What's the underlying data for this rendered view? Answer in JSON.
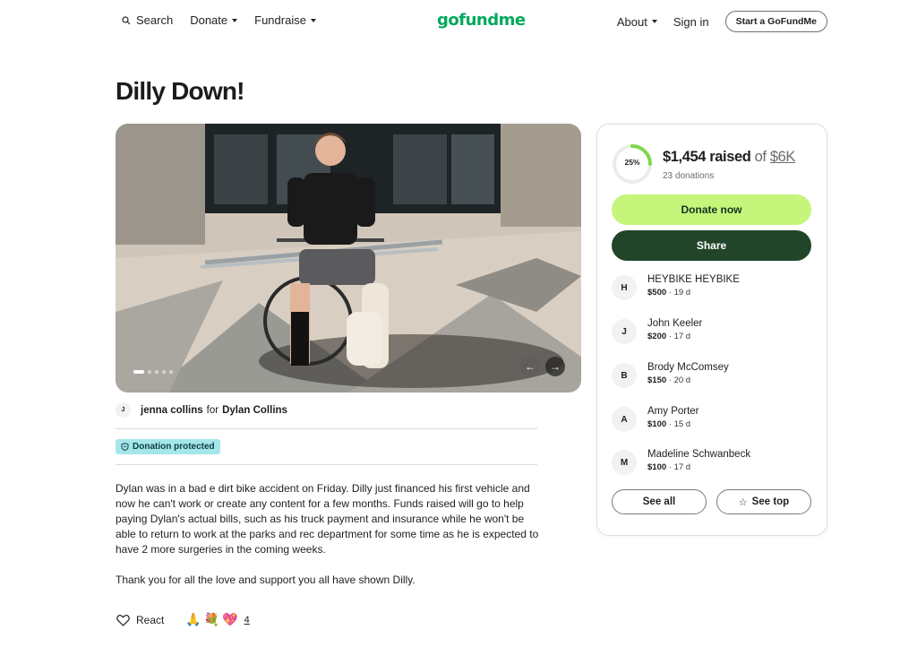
{
  "header": {
    "nav_left": [
      {
        "label": "Search",
        "icon": "search-icon"
      },
      {
        "label": "Donate",
        "has_caret": true
      },
      {
        "label": "Fundraise",
        "has_caret": true
      }
    ],
    "logo": "gofundme",
    "nav_right": {
      "about": "About",
      "signin": "Sign in",
      "start": "Start a GoFundMe"
    }
  },
  "campaign": {
    "title": "Dilly Down!",
    "organizer": {
      "initial": "J",
      "name": "jenna collins",
      "for_word": "for",
      "beneficiary": "Dylan Collins"
    },
    "protected_badge": "Donation protected",
    "story": [
      "Dylan was in a bad e dirt bike accident on Friday. Dilly just financed his first vehicle and now he can't work or create any content for a few months. Funds raised will go to help paying Dylan's actual bills, such as his truck payment and insurance while he won't be able to return to work at the parks and rec department for some time as he is expected to have 2 more surgeries in the coming weeks.",
      "Thank you for all the love and support you all have shown Dilly."
    ],
    "react": {
      "label": "React",
      "emojis": [
        "🙏",
        "💐",
        "💖"
      ],
      "count": "4"
    },
    "carousel": {
      "total_slides": 5,
      "active_slide": 1
    }
  },
  "donation_panel": {
    "progress_percent": 25,
    "progress_label": "25%",
    "raised_amount": "$1,454 raised",
    "of_word": "of",
    "goal": "$6K",
    "donation_count": "23 donations",
    "donate_label": "Donate now",
    "share_label": "Share",
    "donors": [
      {
        "initial": "H",
        "name": "HEYBIKE HEYBIKE",
        "amount": "$500",
        "time": "19 d"
      },
      {
        "initial": "J",
        "name": "John Keeler",
        "amount": "$200",
        "time": "17 d"
      },
      {
        "initial": "B",
        "name": "Brody McComsey",
        "amount": "$150",
        "time": "20 d"
      },
      {
        "initial": "A",
        "name": "Amy Porter",
        "amount": "$100",
        "time": "15 d"
      },
      {
        "initial": "M",
        "name": "Madeline Schwanbeck",
        "amount": "$100",
        "time": "17 d"
      }
    ],
    "see_all_label": "See all",
    "see_top_label": "See top"
  },
  "colors": {
    "brand_green": "#02a95c",
    "donate_button": "#c5f57a",
    "share_button": "#22452a",
    "progress_ring": "#7dd84b",
    "protected_badge": "#a6e6e8"
  }
}
